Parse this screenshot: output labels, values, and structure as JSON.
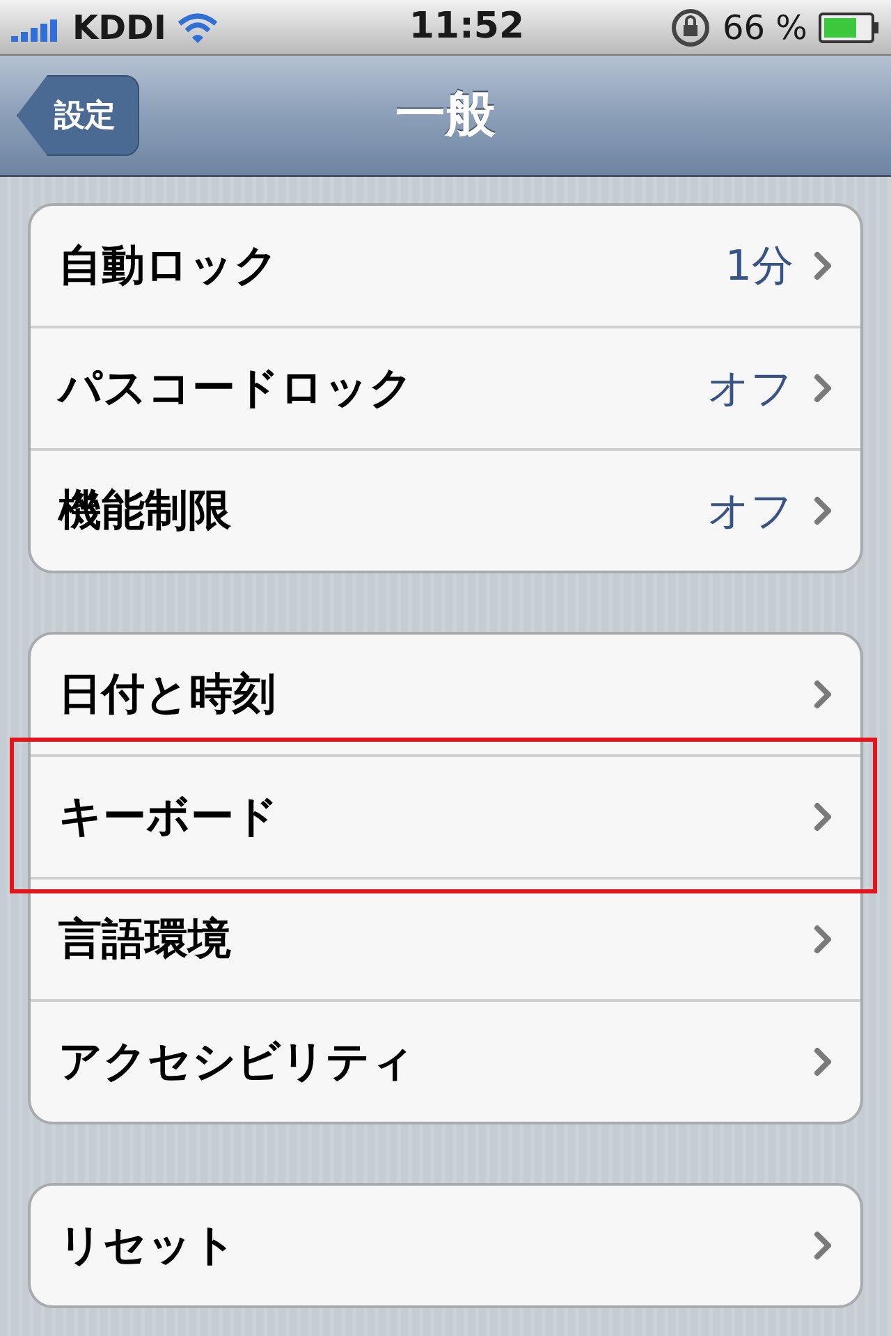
{
  "status_bar": {
    "carrier": "KDDI",
    "time": "11:52",
    "battery": "66 %"
  },
  "nav_bar": {
    "back": "設定",
    "title": "一般"
  },
  "groups": [
    {
      "rows": [
        {
          "label": "自動ロック",
          "value": "1分",
          "highlighted": false
        },
        {
          "label": "パスコードロック",
          "value": "オフ",
          "highlighted": false
        },
        {
          "label": "機能制限",
          "value": "オフ",
          "highlighted": false
        }
      ]
    },
    {
      "rows": [
        {
          "label": "日付と時刻",
          "highlighted": false
        },
        {
          "label": "キーボード",
          "highlighted": true
        },
        {
          "label": "言語環境",
          "highlighted": false
        },
        {
          "label": "アクセシビリティ",
          "highlighted": false
        }
      ]
    },
    {
      "rows": [
        {
          "label": "リセット",
          "highlighted": false
        }
      ]
    }
  ]
}
